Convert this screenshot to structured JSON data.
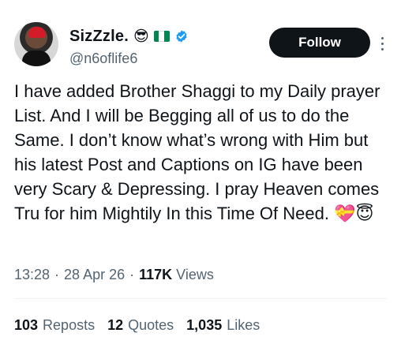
{
  "user": {
    "display_name": "SizZzle.",
    "emoji": "😎",
    "handle": "@n6oflife6",
    "flag_colors": [
      "#008751",
      "#ffffff",
      "#008751"
    ],
    "verified_color": "#1d9bf0"
  },
  "actions": {
    "follow_label": "Follow"
  },
  "tweet": {
    "text": "I have added Brother Shaggi to my Daily prayer List. And I will be Begging all of us to do the Same. I don’t know what’s wrong with Him but his latest Post and Captions on IG have been very Scary & Depressing. I pray Heaven comes Tru for him Mightily In this Time Of Need. 💝😇"
  },
  "meta": {
    "time": "13:28",
    "date": "28 Apr 26",
    "views_count": "117K",
    "views_label": "Views"
  },
  "stats": {
    "reposts_count": "103",
    "reposts_label": "Reposts",
    "quotes_count": "12",
    "quotes_label": "Quotes",
    "likes_count": "1,035",
    "likes_label": "Likes"
  }
}
